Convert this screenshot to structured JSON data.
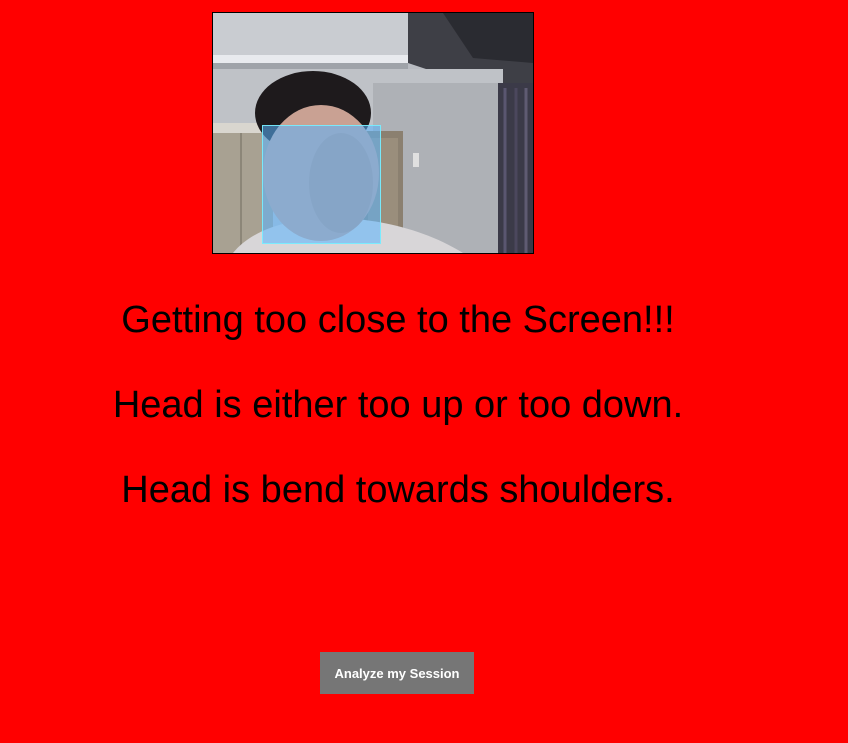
{
  "colors": {
    "background": "#ff0000",
    "button": "#767676",
    "face_overlay": "#5ab4ff"
  },
  "webcam": {
    "icon": "webcam-feed"
  },
  "messages": [
    "Getting too close to the Screen!!!",
    "Head is either too up or too down.",
    "Head is bend towards shoulders."
  ],
  "actions": {
    "analyze_label": "Analyze my Session"
  }
}
